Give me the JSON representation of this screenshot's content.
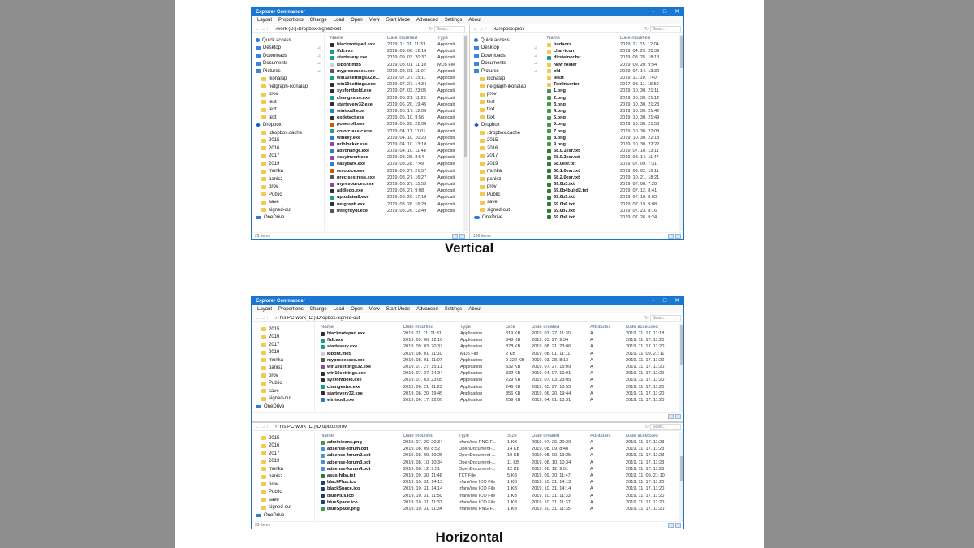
{
  "app_title": "Explorer Commander",
  "menu": [
    "Layout",
    "Proportions",
    "Change",
    "Load",
    "Open",
    "View",
    "Start Mode",
    "Advanced",
    "Settings",
    "About"
  ],
  "search_placeholder": "Searc...",
  "captions": {
    "vertical": "Vertical",
    "horizontal": "Horizontal"
  },
  "vertical": {
    "left": {
      "crumbs": [
        "work (D:)",
        "Dropbox",
        "signed-out"
      ],
      "nav": [
        {
          "label": "Quick access",
          "icon": "star-icon"
        },
        {
          "label": "Desktop",
          "icon": "desktop-icon",
          "pin": true
        },
        {
          "label": "Downloads",
          "icon": "downloads-icon",
          "pin": true
        },
        {
          "label": "Documents",
          "icon": "documents-icon",
          "pin": true
        },
        {
          "label": "Pictures",
          "icon": "pictures-icon",
          "pin": true
        },
        {
          "label": "ikonalap",
          "icon": "folder-icon"
        },
        {
          "label": "netgraph-ikonalap",
          "icon": "folder-icon"
        },
        {
          "label": "prov",
          "icon": "folder-icon"
        },
        {
          "label": "test",
          "icon": "folder-icon"
        },
        {
          "label": "text",
          "icon": "folder-icon"
        },
        {
          "label": "text",
          "icon": "folder-icon"
        },
        {
          "label": "Dropbox",
          "icon": "dropbox-icon"
        },
        {
          "label": ".dropbox.cache",
          "icon": "folder-icon"
        },
        {
          "label": "2015",
          "icon": "folder-icon"
        },
        {
          "label": "2016",
          "icon": "folder-icon"
        },
        {
          "label": "2017",
          "icon": "folder-icon"
        },
        {
          "label": "2019",
          "icon": "folder-icon"
        },
        {
          "label": "munka",
          "icon": "folder-icon"
        },
        {
          "label": "panisz",
          "icon": "folder-icon"
        },
        {
          "label": "prov",
          "icon": "folder-icon"
        },
        {
          "label": "Public",
          "icon": "folder-icon"
        },
        {
          "label": "save",
          "icon": "folder-icon"
        },
        {
          "label": "signed-out",
          "icon": "folder-icon"
        },
        {
          "label": "OneDrive",
          "icon": "onedrive-icon"
        }
      ],
      "columns": [
        "Name",
        "Date modified",
        "Type"
      ],
      "rows": [
        [
          "blacknotepad.exe",
          "2019. 11. 11. 11:31",
          "Applicati"
        ],
        [
          "ffdt.exe",
          "2019. 09. 06. 12:16",
          "Applicati"
        ],
        [
          "startevery.exe",
          "2019. 09. 03. 20:37",
          "Applicati"
        ],
        [
          "kibont.md5",
          "2019. 08. 01. 11:10",
          "MD5 File"
        ],
        [
          "myprocesses.exe",
          "2019. 08. 01. 11:07",
          "Applicati"
        ],
        [
          "win10settings32.e...",
          "2019. 07. 27. 15:11",
          "Applicati"
        ],
        [
          "win10settings.exe",
          "2019. 07. 27. 14:34",
          "Applicati"
        ],
        [
          "sysfontbold.exe",
          "2019. 07. 03. 23:05",
          "Applicati"
        ],
        [
          "changesize.exe",
          "2019. 06. 21. 11:23",
          "Applicati"
        ],
        [
          "startevery32.exe",
          "2019. 06. 20. 19:45",
          "Applicati"
        ],
        [
          "winisodl.exe",
          "2019. 06. 17. 12:00",
          "Applicati"
        ],
        [
          "oxdetect.exe",
          "2019. 06. 10. 9:56",
          "Applicati"
        ],
        [
          "poweroff.exe",
          "2019. 05. 28. 22:08",
          "Applicati"
        ],
        [
          "colorclassic.exe",
          "2019. 04. 11. 11:07",
          "Applicati"
        ],
        [
          "winkey.exe",
          "2019. 04. 10. 10:23",
          "Applicati"
        ],
        [
          "urlblocker.exe",
          "2019. 04. 10. 13:10",
          "Applicati"
        ],
        [
          "advchange.exe",
          "2019. 04. 10. 11:48",
          "Applicati"
        ],
        [
          "easyinvert.exe",
          "2019. 03. 28. 8:54",
          "Applicati"
        ],
        [
          "easydark.exe",
          "2019. 03. 28. 7:49",
          "Applicati"
        ],
        [
          "resource.exe",
          "2019. 03. 27. 21:57",
          "Applicati"
        ],
        [
          "precisestress.exe",
          "2019. 03. 27. 16:27",
          "Applicati"
        ],
        [
          "myresources.exe",
          "2019. 03. 27. 15:53",
          "Applicati"
        ],
        [
          "addledo.exe",
          "2019. 03. 27. 9:08",
          "Applicati"
        ],
        [
          "uptodatedl.exe",
          "2019. 03. 26. 17:18",
          "Applicati"
        ],
        [
          "netgraph.exe",
          "2019. 03. 26. 16:29",
          "Applicati"
        ],
        [
          "integritydl.exe",
          "2019. 03. 26. 12:49",
          "Applicati"
        ]
      ],
      "status": "29 items"
    },
    "right": {
      "crumbs": [
        "Dropbox",
        "prov"
      ],
      "nav": [
        {
          "label": "Quick access",
          "icon": "star-icon"
        },
        {
          "label": "Desktop",
          "icon": "desktop-icon",
          "pin": true
        },
        {
          "label": "Downloads",
          "icon": "downloads-icon",
          "pin": true
        },
        {
          "label": "Documents",
          "icon": "documents-icon",
          "pin": true
        },
        {
          "label": "Pictures",
          "icon": "pictures-icon",
          "pin": true
        },
        {
          "label": "ikonalap",
          "icon": "folder-icon"
        },
        {
          "label": "netgraph-ikonalap",
          "icon": "folder-icon"
        },
        {
          "label": "prov",
          "icon": "folder-icon"
        },
        {
          "label": "test",
          "icon": "folder-icon"
        },
        {
          "label": "text",
          "icon": "folder-icon"
        },
        {
          "label": "text",
          "icon": "folder-icon"
        },
        {
          "label": "Dropbox",
          "icon": "dropbox-icon"
        },
        {
          "label": ".dropbox.cache",
          "icon": "folder-icon"
        },
        {
          "label": "2015",
          "icon": "folder-icon"
        },
        {
          "label": "2016",
          "icon": "folder-icon"
        },
        {
          "label": "2017",
          "icon": "folder-icon"
        },
        {
          "label": "2019",
          "icon": "folder-icon"
        },
        {
          "label": "munka",
          "icon": "folder-icon"
        },
        {
          "label": "panisz",
          "icon": "folder-icon"
        },
        {
          "label": "prov",
          "icon": "folder-icon"
        },
        {
          "label": "Public",
          "icon": "folder-icon"
        },
        {
          "label": "save",
          "icon": "folder-icon"
        },
        {
          "label": "signed-out",
          "icon": "folder-icon"
        },
        {
          "label": "OneDrive",
          "icon": "onedrive-icon"
        }
      ],
      "columns": [
        "Name",
        "Date modified"
      ],
      "rows": [
        [
          "budaors",
          "2019. 11. 15. 12:04"
        ],
        [
          "char-icon",
          "2019. 04. 29. 20:39"
        ],
        [
          "dirsteiner.hu",
          "2019. 03. 25. 18:13"
        ],
        [
          "New folder",
          "2019. 09. 20. 9:54"
        ],
        [
          "old",
          "2019. 07. 14. 13:39"
        ],
        [
          "teszt",
          "2019. 11. 10. 7:40"
        ],
        [
          "TextInserter",
          "2017. 08. 11. 18:59"
        ],
        [
          "1.png",
          "2019. 10. 30. 21:11"
        ],
        [
          "2.png",
          "2019. 10. 30. 21:12"
        ],
        [
          "3.png",
          "2019. 10. 30. 21:23"
        ],
        [
          "4.png",
          "2019. 10. 30. 21:42"
        ],
        [
          "5.png",
          "2019. 10. 30. 21:49"
        ],
        [
          "6.png",
          "2019. 10. 30. 21:58"
        ],
        [
          "7.png",
          "2019. 10. 30. 22:08"
        ],
        [
          "8.png",
          "2019. 10. 30. 22:18"
        ],
        [
          "9.png",
          "2019. 10. 30. 22:22"
        ],
        [
          "68.0.1esr.txt",
          "2019. 07. 10. 13:11"
        ],
        [
          "68.0.2esr.txt",
          "2019. 08. 14. 11:47"
        ],
        [
          "68.0esr.txt",
          "2019. 07. 09. 7:31"
        ],
        [
          "68.1.0esr.txt",
          "2019. 09. 02. 16:11"
        ],
        [
          "68.2.0esr.txt",
          "2019. 10. 21. 18:21"
        ],
        [
          "69.0b3.txt",
          "2019. 07. 08. 7:28"
        ],
        [
          "69.0b4build2.txt",
          "2019. 07. 12. 8:41"
        ],
        [
          "69.0b5.txt",
          "2019. 07. 16. 8:03"
        ],
        [
          "69.0b6.txt",
          "2019. 07. 19. 9:08"
        ],
        [
          "69.0b7.txt",
          "2019. 07. 23. 8:16"
        ],
        [
          "69.0b8.txt",
          "2019. 07. 26. 9:24"
        ]
      ],
      "status": "166 items"
    }
  },
  "horizontal": {
    "top": {
      "crumbs": [
        "This PC",
        "work (D:)",
        "Dropbox",
        "signed-out"
      ],
      "nav": [
        {
          "label": "2015",
          "icon": "folder-icon"
        },
        {
          "label": "2016",
          "icon": "folder-icon"
        },
        {
          "label": "2017",
          "icon": "folder-icon"
        },
        {
          "label": "2019",
          "icon": "folder-icon"
        },
        {
          "label": "munka",
          "icon": "folder-icon"
        },
        {
          "label": "panisz",
          "icon": "folder-icon"
        },
        {
          "label": "prov",
          "icon": "folder-icon"
        },
        {
          "label": "Public",
          "icon": "folder-icon"
        },
        {
          "label": "save",
          "icon": "folder-icon"
        },
        {
          "label": "signed-out",
          "icon": "folder-icon"
        },
        {
          "label": "OneDrive",
          "icon": "onedrive-icon"
        }
      ],
      "columns": [
        "Name",
        "Date modified",
        "Type",
        "Size",
        "Date created",
        "Attributes",
        "Date accessed"
      ],
      "rows": [
        [
          "blacknotepad.exe",
          "2019. 11. 11. 11:31",
          "Application",
          "319 KB",
          "2019. 03. 27. 11:30",
          "A",
          "2019. 11. 17. 11:18"
        ],
        [
          "ffdt.exe",
          "2019. 09. 06. 12:16",
          "Application",
          "343 KB",
          "2019. 03. 27. 9:34",
          "A",
          "2019. 11. 17. 11:20"
        ],
        [
          "startevery.exe",
          "2019. 09. 03. 20:37",
          "Application",
          "378 KB",
          "2019. 08. 21. 23:06",
          "A",
          "2019. 11. 17. 11:20"
        ],
        [
          "kibont.md5",
          "2019. 08. 01. 11:10",
          "MD5 File",
          "2 KB",
          "2019. 08. 01. 11:11",
          "A",
          "2019. 11. 09. 21:11"
        ],
        [
          "myprocesses.exe",
          "2019. 08. 01. 11:07",
          "Application",
          "2 322 KB",
          "2019. 03. 28. 8:13",
          "A",
          "2019. 11. 17. 11:20"
        ],
        [
          "win10settings32.exe",
          "2019. 07. 27. 15:11",
          "Application",
          "332 KB",
          "2019. 07. 27. 15:09",
          "A",
          "2019. 11. 17. 11:20"
        ],
        [
          "win10settings.exe",
          "2019. 07. 27. 14:34",
          "Application",
          "332 KB",
          "2019. 04. 07. 10:01",
          "A",
          "2019. 11. 17. 11:20"
        ],
        [
          "sysfontbold.exe",
          "2019. 07. 03. 23:05",
          "Application",
          "229 KB",
          "2019. 07. 03. 23:05",
          "A",
          "2019. 11. 17. 11:20"
        ],
        [
          "changesize.exe",
          "2019. 06. 21. 11:23",
          "Application",
          "246 KB",
          "2019. 05. 27. 10:55",
          "A",
          "2019. 11. 17. 11:20"
        ],
        [
          "startevery32.exe",
          "2019. 06. 20. 19:45",
          "Application",
          "356 KB",
          "2019. 06. 20. 19:44",
          "A",
          "2019. 11. 17. 11:20"
        ],
        [
          "winisodl.exe",
          "2019. 06. 17. 12:00",
          "Application",
          "259 KB",
          "2019. 04. 01. 13:31",
          "A",
          "2019. 11. 17. 11:20"
        ]
      ],
      "status": ""
    },
    "bottom": {
      "crumbs": [
        "This PC",
        "work (D:)",
        "Dropbox",
        "prov"
      ],
      "nav": [
        {
          "label": "2015",
          "icon": "folder-icon"
        },
        {
          "label": "2016",
          "icon": "folder-icon"
        },
        {
          "label": "2017",
          "icon": "folder-icon"
        },
        {
          "label": "2019",
          "icon": "folder-icon"
        },
        {
          "label": "munka",
          "icon": "folder-icon"
        },
        {
          "label": "panisz",
          "icon": "folder-icon"
        },
        {
          "label": "prov",
          "icon": "folder-icon"
        },
        {
          "label": "Public",
          "icon": "folder-icon"
        },
        {
          "label": "save",
          "icon": "folder-icon"
        },
        {
          "label": "signed-out",
          "icon": "folder-icon"
        },
        {
          "label": "OneDrive",
          "icon": "onedrive-icon"
        }
      ],
      "columns": [
        "Name",
        "Date modified",
        "Type",
        "Size",
        "Date created",
        "Attributes",
        "Date accessed"
      ],
      "rows": [
        [
          "adminicons.png",
          "2019. 07. 26. 20:34",
          "IrfanView PNG F...",
          "1 KB",
          "2019. 07. 26. 20:30",
          "A",
          "2019. 11. 17. 11:23"
        ],
        [
          "adsense-forum.odt",
          "2019. 08. 09. 8:52",
          "OpenDocument-...",
          "14 KB",
          "2019. 08. 09. 8:48",
          "A",
          "2019. 11. 17. 11:23"
        ],
        [
          "adsense-forum2.odt",
          "2019. 08. 09. 19:25",
          "OpenDocument-...",
          "10 KB",
          "2019. 08. 09. 19:25",
          "A",
          "2019. 11. 17. 11:23"
        ],
        [
          "adsense-forum3.odt",
          "2019. 08. 10. 10:34",
          "OpenDocument-...",
          "11 KB",
          "2019. 08. 10. 10:34",
          "A",
          "2019. 11. 17. 11:23"
        ],
        [
          "adsense-forum4.odt",
          "2019. 08. 12. 9:51",
          "OpenDocument-...",
          "12 KB",
          "2019. 08. 12. 9:51",
          "A",
          "2019. 11. 17. 11:23"
        ],
        [
          "asus-hiba.txt",
          "2019. 09. 30. 11:46",
          "TXT File",
          "5 KB",
          "2019. 09. 30. 11:47",
          "A",
          "2019. 11. 09. 21:10"
        ],
        [
          "blackPlus.ico",
          "2019. 10. 31. 14:13",
          "IrfanView ICO File",
          "1 KB",
          "2019. 10. 31. 14:13",
          "A",
          "2019. 11. 17. 11:20"
        ],
        [
          "blackSpace.ico",
          "2019. 10. 31. 14:14",
          "IrfanView ICO File",
          "1 KB",
          "2019. 10. 31. 14:14",
          "A",
          "2019. 11. 17. 11:20"
        ],
        [
          "bluePlus.ico",
          "2019. 10. 31. 11:50",
          "IrfanView ICO File",
          "1 KB",
          "2019. 10. 31. 11:33",
          "A",
          "2019. 11. 17. 11:20"
        ],
        [
          "blueSpace.ico",
          "2019. 10. 31. 11:37",
          "IrfanView ICO File",
          "1 KB",
          "2019. 10. 31. 11:37",
          "A",
          "2019. 11. 17. 11:20"
        ],
        [
          "blueSpace.png",
          "2019. 10. 31. 11:34",
          "IrfanView PNG F...",
          "1 KB",
          "2019. 10. 31. 11:35",
          "A",
          "2019. 11. 17. 11:20"
        ]
      ],
      "status": "93 items"
    }
  }
}
